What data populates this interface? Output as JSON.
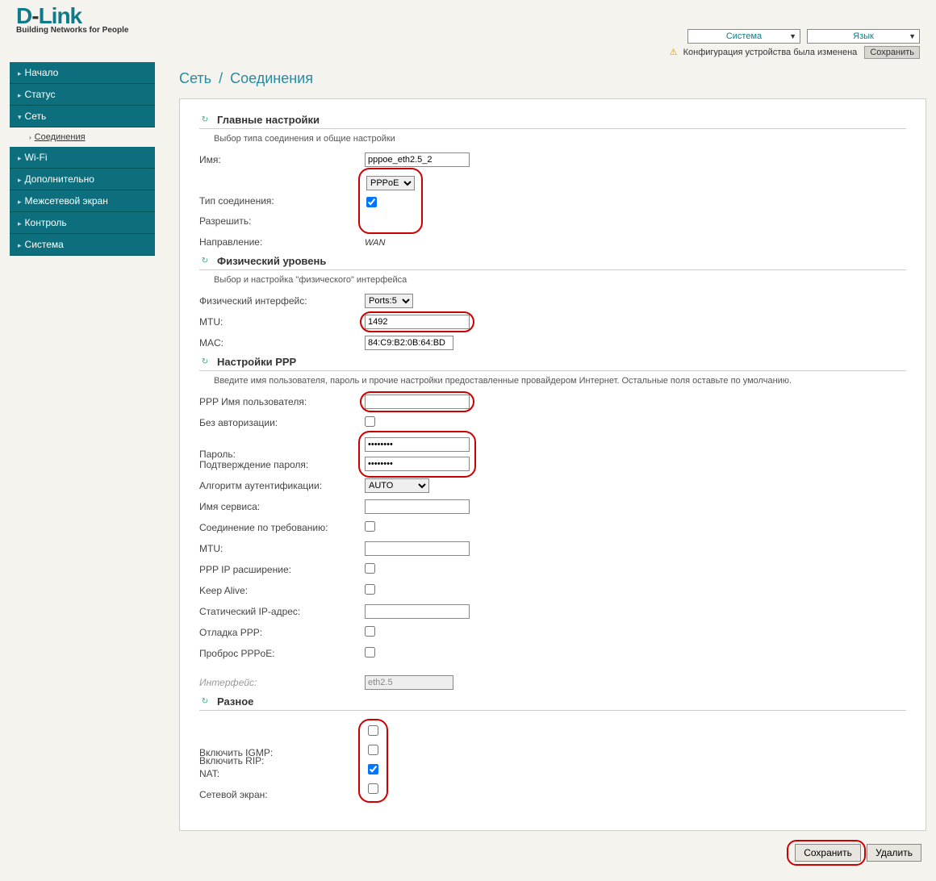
{
  "logo": {
    "brand_pre": "D",
    "brand_mid": "-",
    "brand_post": "Link",
    "tagline": "Building Networks for People"
  },
  "top_dropdowns": {
    "system": "Система",
    "language": "Язык"
  },
  "notice": {
    "text": "Конфигурация устройства была изменена",
    "save": "Сохранить"
  },
  "sidebar": {
    "items": [
      {
        "label": "Начало"
      },
      {
        "label": "Статус"
      },
      {
        "label": "Сеть",
        "active": true
      },
      {
        "label": "Wi-Fi"
      },
      {
        "label": "Дополнительно"
      },
      {
        "label": "Межсетевой экран"
      },
      {
        "label": "Контроль"
      },
      {
        "label": "Система"
      }
    ],
    "sub_label": "Соединения"
  },
  "breadcrumb": {
    "a": "Сеть",
    "sep": "/",
    "b": "Соединения"
  },
  "sections": {
    "main": {
      "title": "Главные настройки",
      "desc": "Выбор типа соединения и общие настройки",
      "name_label": "Имя:",
      "name_value": "pppoe_eth2.5_2",
      "type_label": "Тип соединения:",
      "type_value": "PPPoE",
      "allow_label": "Разрешить:",
      "direction_label": "Направление:",
      "direction_value": "WAN"
    },
    "phys": {
      "title": "Физический уровень",
      "desc": "Выбор и настройка \"физического\" интерфейса",
      "iface_label": "Физический интерфейс:",
      "iface_value": "Ports:5",
      "mtu_label": "MTU:",
      "mtu_value": "1492",
      "mac_label": "MAC:",
      "mac_value": "84:C9:B2:0B:64:BD"
    },
    "ppp": {
      "title": "Настройки PPP",
      "desc": "Введите имя пользователя, пароль и прочие настройки предоставленные провайдером Интернет. Остальные поля оставьте по умолчанию.",
      "user_label": "PPP Имя пользователя:",
      "user_value": "",
      "noauth_label": "Без авторизации:",
      "pass_label": "Пароль:",
      "pass_value": "••••••••",
      "pass2_label": "Подтверждение пароля:",
      "pass2_value": "••••••••",
      "auth_label": "Алгоритм аутентификации:",
      "auth_value": "AUTO",
      "service_label": "Имя сервиса:",
      "ondemand_label": "Соединение по требованию:",
      "mtu_label": "MTU:",
      "pppext_label": "PPP IP расширение:",
      "keepalive_label": "Keep Alive:",
      "staticip_label": "Статический IP-адрес:",
      "debug_label": "Отладка PPP:",
      "passthru_label": "Проброс PPPoE:",
      "iface_label": "Интерфейс:",
      "iface_value": "eth2.5"
    },
    "misc": {
      "title": "Разное",
      "rip_label": "Включить RIP:",
      "igmp_label": "Включить IGMP:",
      "nat_label": "NAT:",
      "fw_label": "Сетевой экран:"
    }
  },
  "footer": {
    "save": "Сохранить",
    "delete": "Удалить"
  }
}
